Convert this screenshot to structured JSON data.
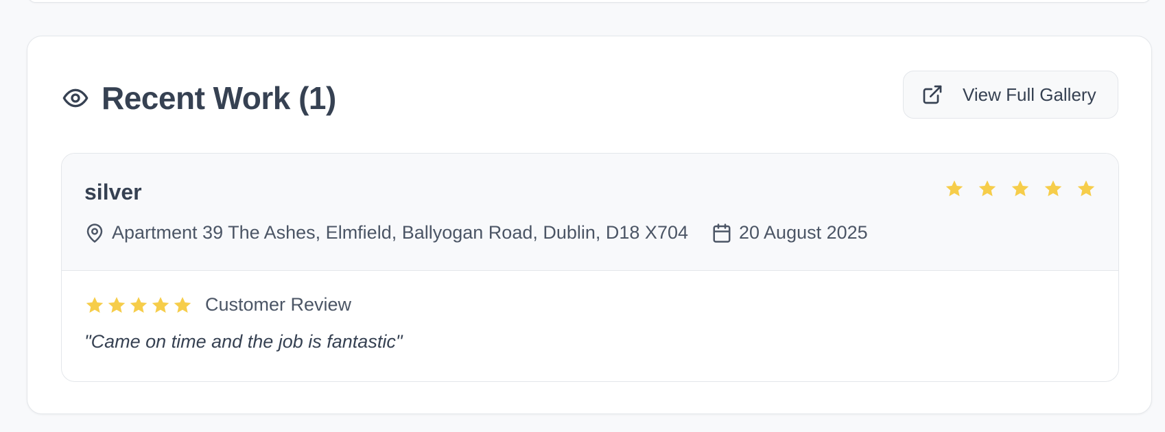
{
  "section": {
    "title": "Recent Work (1)",
    "title_icon": "eye-icon",
    "gallery_button_label": "View Full Gallery",
    "gallery_button_icon": "external-link-icon"
  },
  "work_items": [
    {
      "title": "silver",
      "rating": 5,
      "rating_max": 5,
      "address": "Apartment 39 The Ashes, Elmfield, Ballyogan Road, Dublin, D18 X704",
      "date": "20 August 2025",
      "review": {
        "rating": 5,
        "label": "Customer Review",
        "quote": "\"Came on time and the job is fantastic\""
      }
    }
  ],
  "colors": {
    "star": "#f6cd4a",
    "text": "#364152",
    "muted": "#4b5565",
    "border": "#e3e6ea",
    "background": "#f8f9fb"
  }
}
